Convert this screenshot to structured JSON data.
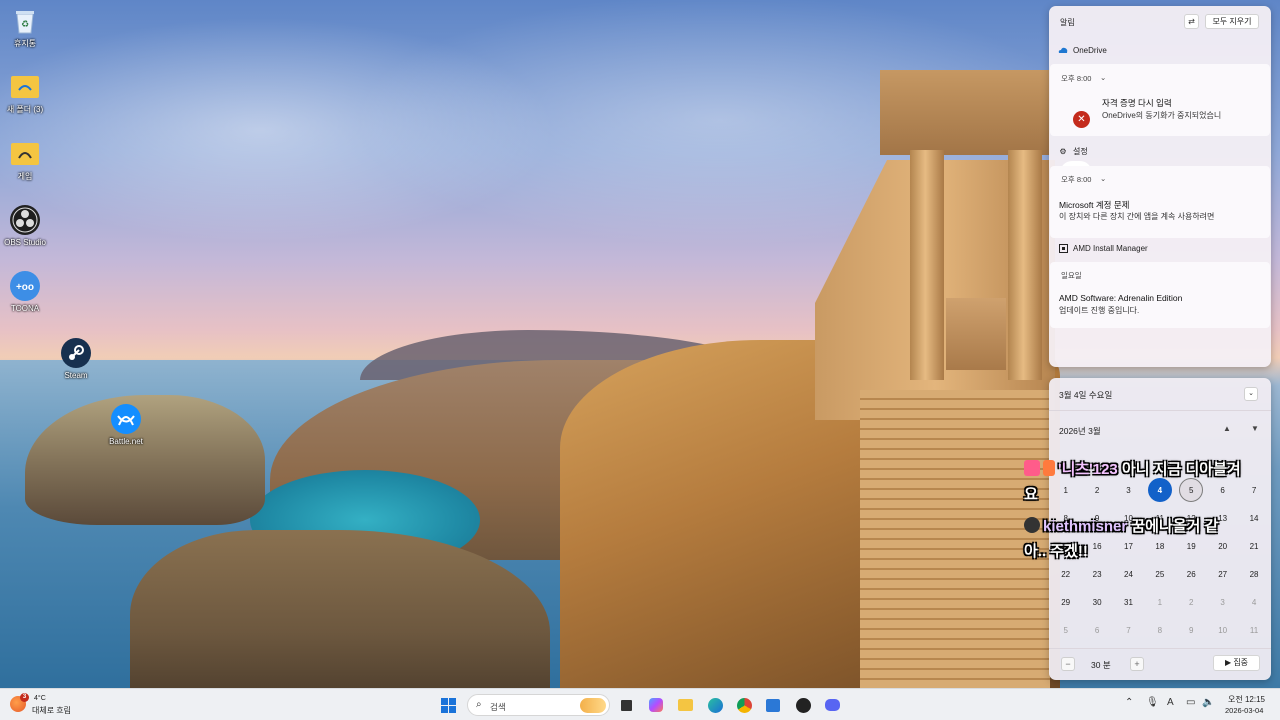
{
  "desktop": {
    "icons": [
      {
        "label": "휴지통",
        "icon": "recycle-bin-icon"
      },
      {
        "label": "새 폴더 (3)",
        "icon": "folder-icon"
      },
      {
        "label": "게임",
        "icon": "folder-icon"
      },
      {
        "label": "OBS Studio",
        "icon": "obs-icon"
      },
      {
        "label": "TOONA",
        "icon": "toona-icon"
      },
      {
        "label": "Steam",
        "icon": "steam-icon"
      },
      {
        "label": "Battle.net",
        "icon": "battlenet-icon"
      }
    ]
  },
  "notifications": {
    "title": "알림",
    "clear_all": "모두 지우기",
    "groups": [
      {
        "app": "OneDrive",
        "time": "오후 8:00",
        "title": "자격 증명 다시 입력",
        "body": "OneDrive의 동기화가 중지되었습니"
      },
      {
        "app": "설정",
        "time": "오후 8:00",
        "title": "Microsoft 계정 문제",
        "body": "이 장치와 다른 장치 간에 앱을 계속 사용하려면"
      },
      {
        "app": "AMD Install Manager",
        "time": "일요일",
        "title": "AMD Software: Adrenalin Edition",
        "body": "업데이트 진행 중입니다."
      }
    ]
  },
  "calendar": {
    "date_header": "3월 4일 수요일",
    "month_label": "2026년 3월",
    "rows": [
      [
        "1",
        "2",
        "3",
        "4",
        "5",
        "6",
        "7"
      ],
      [
        "8",
        "9",
        "10",
        "11",
        "12",
        "13",
        "14"
      ],
      [
        "15",
        "16",
        "17",
        "18",
        "19",
        "20",
        "21"
      ],
      [
        "22",
        "23",
        "24",
        "25",
        "26",
        "27",
        "28"
      ],
      [
        "29",
        "30",
        "31",
        "1",
        "2",
        "3",
        "4"
      ],
      [
        "5",
        "6",
        "7",
        "8",
        "9",
        "10",
        "11"
      ]
    ],
    "today": "4",
    "focus_minutes": "30 분",
    "focus_button": "▶ 집중"
  },
  "chat": {
    "msg1_user": "'니츠'123",
    "msg1_text_a": "아니 지금 디아블겨",
    "msg1_text_b": "요",
    "msg2_user": "kiethmisner",
    "msg2_text_a": "꿈에나올거 같",
    "msg2_text_b": "아.. 주겠!!"
  },
  "taskbar": {
    "weather_badge": "3",
    "weather_temp": "4°C",
    "weather_desc": "대체로 흐림",
    "search_placeholder": "검색",
    "time": "오전 12:15",
    "date": "2026-03-04"
  },
  "colors": {
    "accent": "#1261c9",
    "error": "#c42b1c"
  }
}
